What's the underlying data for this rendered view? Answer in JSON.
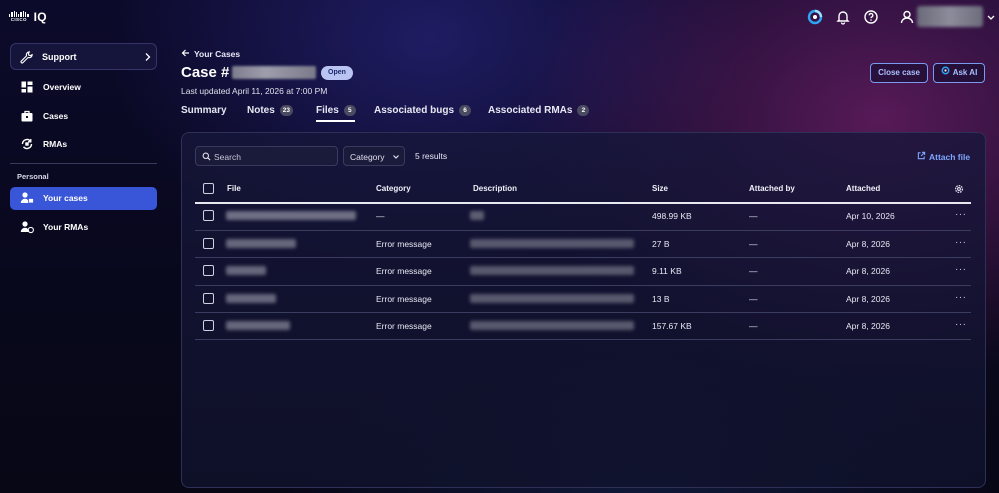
{
  "app": {
    "brand": "CISCO",
    "name": "IQ"
  },
  "topbar": {
    "icons": [
      "ai-assistant-icon",
      "bell-icon",
      "help-icon",
      "user-icon",
      "chevron-down-icon"
    ]
  },
  "sidebar": {
    "support_label": "Support",
    "items": [
      {
        "label": "Overview",
        "icon": "dashboard-icon"
      },
      {
        "label": "Cases",
        "icon": "briefcase-icon"
      },
      {
        "label": "RMAs",
        "icon": "rma-icon"
      }
    ],
    "personal_label": "Personal",
    "personal_items": [
      {
        "label": "Your cases",
        "icon": "user-cases-icon",
        "active": true
      },
      {
        "label": "Your RMAs",
        "icon": "user-rmas-icon",
        "active": false
      }
    ]
  },
  "header": {
    "back_label": "Your Cases",
    "case_title": "Case #",
    "status": "Open",
    "last_updated": "Last updated April 11, 2026 at 7:00 PM",
    "close_case_label": "Close case",
    "ask_ai_label": "Ask AI"
  },
  "tabs": [
    {
      "label": "Summary",
      "count": null
    },
    {
      "label": "Notes",
      "count": "23"
    },
    {
      "label": "Files",
      "count": "5",
      "active": true
    },
    {
      "label": "Associated bugs",
      "count": "6"
    },
    {
      "label": "Associated RMAs",
      "count": "2"
    }
  ],
  "files": {
    "search_placeholder": "Search",
    "category_filter_label": "Category",
    "results_label": "5 results",
    "attach_label": "Attach file",
    "columns": [
      "File",
      "Category",
      "Description",
      "Size",
      "Attached by",
      "Attached"
    ],
    "rows": [
      {
        "category": "—",
        "size": "498.99 KB",
        "attached_by": "—",
        "attached": "Apr 10, 2026"
      },
      {
        "category": "Error message",
        "size": "27 B",
        "attached_by": "—",
        "attached": "Apr 8, 2026"
      },
      {
        "category": "Error message",
        "size": "9.11 KB",
        "attached_by": "—",
        "attached": "Apr 8, 2026"
      },
      {
        "category": "Error message",
        "size": "13 B",
        "attached_by": "—",
        "attached": "Apr 8, 2026"
      },
      {
        "category": "Error message",
        "size": "157.67 KB",
        "attached_by": "—",
        "attached": "Apr 8, 2026"
      }
    ]
  },
  "colors": {
    "accent": "#3a56d8",
    "link": "#7ea5ff",
    "status_pill_bg": "#b9c4f3"
  }
}
